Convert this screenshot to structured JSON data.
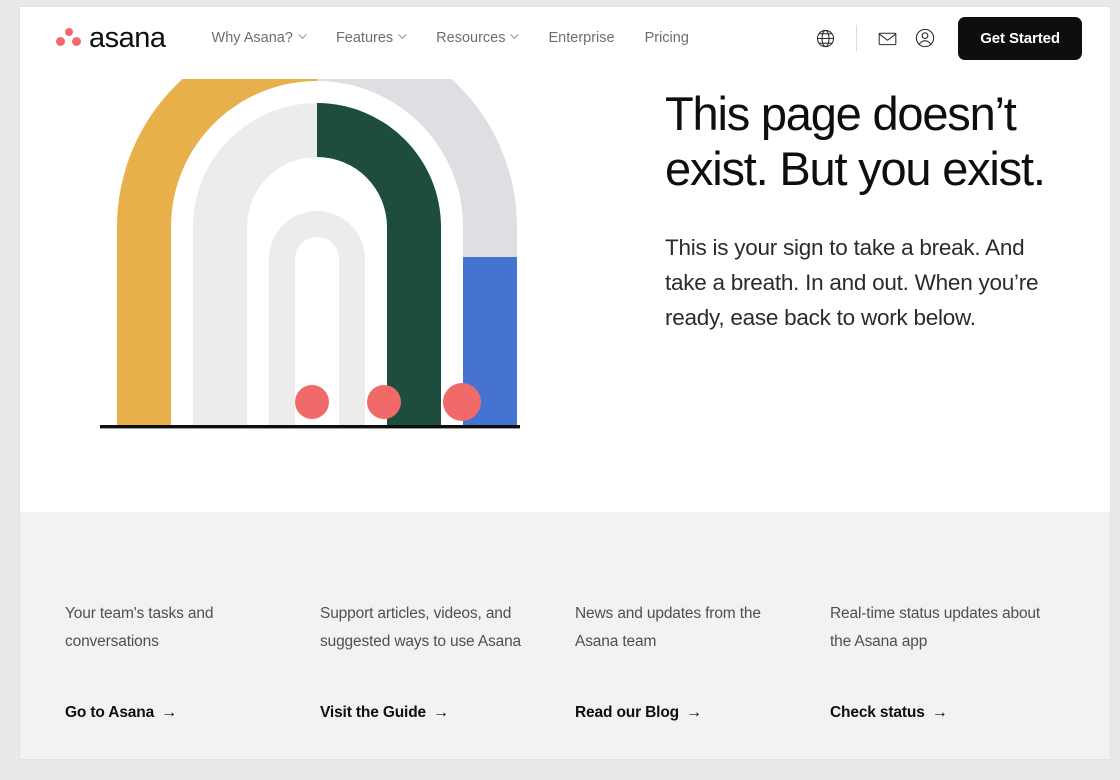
{
  "brand": {
    "name": "asana",
    "logo_icon": "asana-logo-dots",
    "colors": {
      "coral": "#f06a6a",
      "gold": "#e8b04b",
      "green": "#1e4d3e",
      "blue": "#4573d2",
      "lavender_gray": "#dedee3",
      "light_gray": "#ececeb",
      "mid_gray": "#e2e2e1",
      "ink": "#0d0e10",
      "footer_bg": "#f3f2f2"
    }
  },
  "nav": {
    "links": [
      {
        "label": "Why Asana?",
        "has_dropdown": true,
        "icon": "chevron-down-icon"
      },
      {
        "label": "Features",
        "has_dropdown": true,
        "icon": "chevron-down-icon"
      },
      {
        "label": "Resources",
        "has_dropdown": true,
        "icon": "chevron-down-icon"
      },
      {
        "label": "Enterprise",
        "has_dropdown": false,
        "icon": ""
      },
      {
        "label": "Pricing",
        "has_dropdown": false,
        "icon": ""
      }
    ],
    "icons": [
      {
        "name": "globe-icon",
        "label": "Language"
      },
      {
        "name": "envelope-icon",
        "label": "Contact"
      },
      {
        "name": "account-icon",
        "label": "Account"
      }
    ],
    "cta": {
      "label": "Get Started",
      "bg": "#0d0e10",
      "color": "#ffffff"
    }
  },
  "hero": {
    "headline": "This page doesn’t exist. But you exist.",
    "subtext": "This is your sign to take a break. And take a breath. In and out. When you’re ready, ease back to work below.",
    "illustration": {
      "name": "nested-arches-illustration",
      "arches": [
        {
          "left_color": "#e8b04b",
          "right_color": "#dedee3"
        },
        {
          "left_color": "#ececeb",
          "right_color": "#1e4d3e"
        },
        {
          "left_color": "#ececeb",
          "right_color": "#ececeb"
        }
      ],
      "accent_bar_color": "#4573d2",
      "dots_color": "#f06a6a",
      "dots_count": 3,
      "baseline_color": "#0d0e10"
    }
  },
  "footer": {
    "columns": [
      {
        "description": "Your team's tasks and conversations",
        "link_label": "Go to Asana",
        "arrow": "→"
      },
      {
        "description": "Support articles, videos, and suggested ways to use Asana",
        "link_label": "Visit the Guide",
        "arrow": "→"
      },
      {
        "description": "News and updates from the Asana team",
        "link_label": "Read our Blog",
        "arrow": "→"
      },
      {
        "description": "Real-time status updates about the Asana app",
        "link_label": "Check status",
        "arrow": "→"
      }
    ]
  }
}
